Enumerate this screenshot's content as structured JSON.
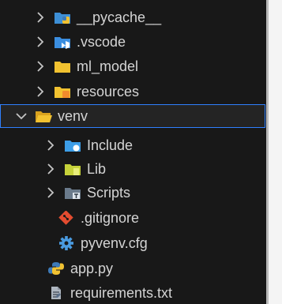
{
  "explorer": {
    "items": [
      {
        "label": "__pycache__",
        "icon": "python-folder-icon"
      },
      {
        "label": ".vscode",
        "icon": "vscode-folder-icon"
      },
      {
        "label": "ml_model",
        "icon": "folder-icon"
      },
      {
        "label": "resources",
        "icon": "resources-folder-icon"
      },
      {
        "label": "venv",
        "icon": "folder-open-icon"
      },
      {
        "label": "Include",
        "icon": "include-folder-icon"
      },
      {
        "label": "Lib",
        "icon": "lib-folder-icon"
      },
      {
        "label": "Scripts",
        "icon": "scripts-folder-icon"
      },
      {
        "label": ".gitignore",
        "icon": "git-icon"
      },
      {
        "label": "pyvenv.cfg",
        "icon": "gear-icon"
      },
      {
        "label": "app.py",
        "icon": "python-icon"
      },
      {
        "label": "requirements.txt",
        "icon": "text-file-icon"
      }
    ]
  },
  "colors": {
    "background": "#181818",
    "text": "#d4d4d4",
    "selection_border": "#2f80ff",
    "folder_yellow": "#f2c230",
    "python_blue": "#3d7ab8",
    "python_yellow": "#f1c232"
  }
}
